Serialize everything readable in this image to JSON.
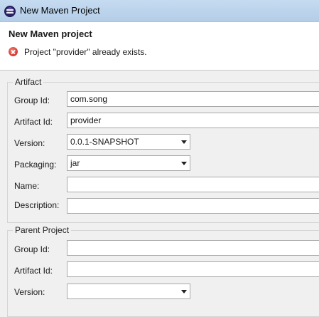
{
  "window": {
    "title": "New Maven Project"
  },
  "header": {
    "title": "New Maven project",
    "error_message": "Project \"provider\" already exists."
  },
  "artifact": {
    "legend": "Artifact",
    "group_id_label": "Group Id:",
    "group_id_value": "com.song",
    "artifact_id_label": "Artifact Id:",
    "artifact_id_value": "provider",
    "version_label": "Version:",
    "version_value": "0.0.1-SNAPSHOT",
    "packaging_label": "Packaging:",
    "packaging_value": "jar",
    "name_label": "Name:",
    "name_value": "",
    "description_label": "Description:",
    "description_value": ""
  },
  "parent": {
    "legend": "Parent Project",
    "group_id_label": "Group Id:",
    "group_id_value": "",
    "artifact_id_label": "Artifact Id:",
    "artifact_id_value": "",
    "version_label": "Version:",
    "version_value": ""
  },
  "colors": {
    "error": "#c81e1e",
    "titlebar": "#c5dbf0"
  }
}
